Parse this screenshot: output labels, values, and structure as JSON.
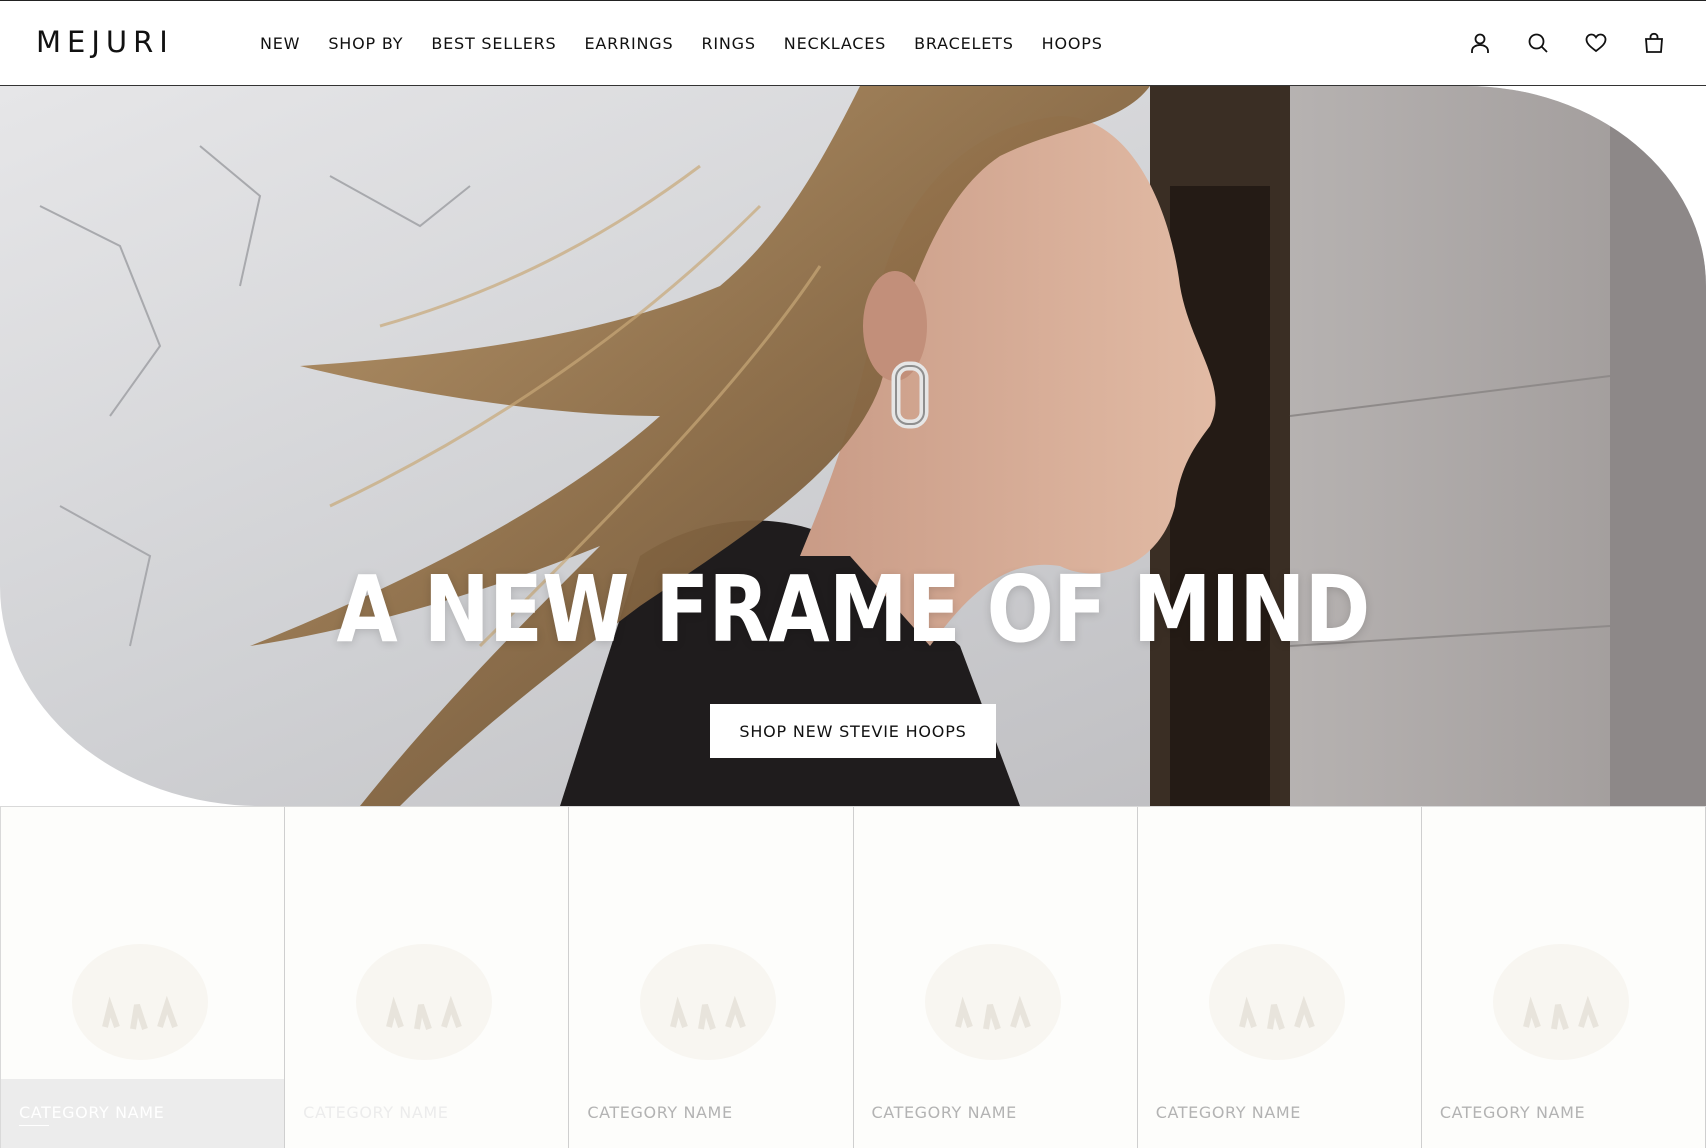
{
  "brand": {
    "logo_text": "MEJURI"
  },
  "nav": {
    "items": [
      {
        "label": "NEW"
      },
      {
        "label": "SHOP BY"
      },
      {
        "label": "BEST SELLERS"
      },
      {
        "label": "EARRINGS"
      },
      {
        "label": "RINGS"
      },
      {
        "label": "NECKLACES"
      },
      {
        "label": "BRACELETS"
      },
      {
        "label": "HOOPS"
      }
    ]
  },
  "header_icons": [
    "account-icon",
    "search-icon",
    "wishlist-heart-icon",
    "shopping-bag-icon"
  ],
  "hero": {
    "title": "A NEW FRAME OF MIND",
    "cta_label": "SHOP NEW STEVIE HOOPS"
  },
  "categories": [
    {
      "label": "CATEGORY NAME"
    },
    {
      "label": "CATEGORY NAME"
    },
    {
      "label": "CATEGORY NAME"
    },
    {
      "label": "CATEGORY NAME"
    },
    {
      "label": "CATEGORY NAME"
    },
    {
      "label": "CATEGORY NAME"
    }
  ],
  "colors": {
    "text": "#111111",
    "cta_background": "#ffffff",
    "category_label": "#b3b3b3",
    "card_background": "#fdfdfb"
  }
}
